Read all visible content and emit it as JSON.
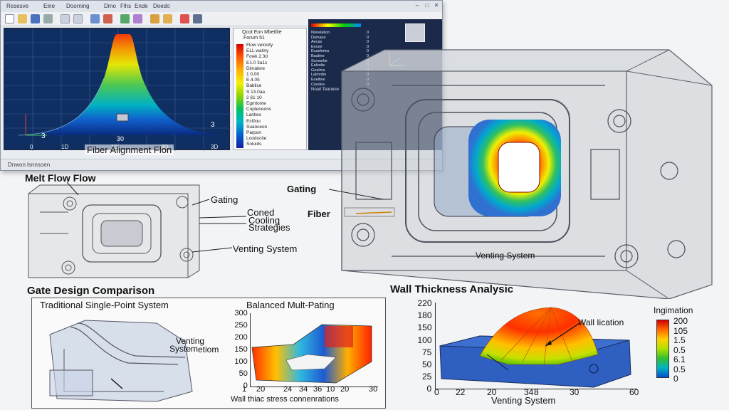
{
  "window": {
    "title_items": [
      "Resesve",
      "Eine",
      "Doorning",
      "Dmo",
      "Flhs",
      "Ende",
      "Deedo"
    ],
    "status_text": "Dnwon lsnnsoen",
    "toolbar_icons": [
      "new-icon",
      "open-icon",
      "save-icon",
      "print-icon",
      "undo-icon",
      "redo-icon",
      "zoom-icon",
      "rotate-icon",
      "mesh-icon",
      "analysis-icon",
      "results-icon",
      "folder-icon",
      "flag-icon",
      "camera-icon"
    ]
  },
  "plot": {
    "title": "Fiber Alignment Flon",
    "x_ticks": [
      "0",
      "1D",
      "10",
      "3D",
      "3D"
    ],
    "y_ticks": [
      "3",
      "3"
    ],
    "peak_label": "30"
  },
  "legend": {
    "header": "Qcot Eon Mbetilte",
    "subheader": "Forum 51",
    "colors": [
      "#d60000",
      "#ff5a00",
      "#ffb000",
      "#f3f000",
      "#8fd400",
      "#00c060",
      "#00b4c8",
      "#0060d0",
      "#1020a0"
    ],
    "entries": [
      "Flow velocity",
      "ELL waliny",
      "Fowk 2.3d",
      "E1.0 3a1s",
      "Dimalere",
      "1 0.00",
      "E.4.05",
      "Bablice",
      "S 13.0aa",
      "2 61 10",
      "Egmtonte",
      "Copteneons",
      "Larities",
      "Eci0ou",
      "Suanceon",
      "Parpon",
      "Loodocite",
      "Soluids"
    ]
  },
  "datapanel": {
    "rows": [
      "Nonelation",
      "Dumaos",
      "Aecas",
      "Eocee",
      "Ecaelmins",
      "Baalme",
      "Scmonlte",
      "Ealsnlie",
      "Goalma",
      "Lalmnbn",
      "Eoeltive",
      "Coodes"
    ],
    "values": [
      "0",
      "0",
      "0",
      "0",
      "0",
      "0",
      "0",
      "0",
      "0",
      "0",
      "0",
      "0"
    ],
    "footer": "Noarl Teaneoe"
  },
  "labels": {
    "melt_flow": "Melt Flow Flow",
    "gating_left": "Gating",
    "coned": "Coned",
    "cooling": "Cooling",
    "strategies": "Strategies",
    "fiber": "Fiber",
    "gating_right": "Gating",
    "venting_left": "Venting System",
    "venting_big": "Venting System"
  },
  "gate_section": {
    "title": "Gate Design Comparison",
    "left_title": "Traditional Single-Point System",
    "right_title": "Balanced Mult-Pating",
    "venting_label_1": "Venting",
    "venting_label_2": "System",
    "y_ticks": [
      "300",
      "250",
      "200",
      "150",
      "100",
      "50",
      "0"
    ],
    "x_ticks": [
      "1",
      "20",
      "24",
      "34",
      "36",
      "10",
      "20",
      "30"
    ],
    "xlabel": "Wall thiac stress connenrations"
  },
  "wall_section": {
    "title": "Wall Thickness Analysic",
    "y_ticks": [
      "220",
      "180",
      "150",
      "100",
      "75",
      "50",
      "25",
      "0"
    ],
    "x_ticks": [
      "0",
      "22",
      "20",
      "34",
      "8",
      "30",
      "60"
    ],
    "xlabel": "Venting System",
    "annotation": "Wall Iication",
    "colorbar_title": "Ingimation",
    "colorbar_ticks": [
      "200",
      "105",
      "1.5",
      "0.5",
      "6.1",
      "0.5",
      "0"
    ],
    "colorbar_colors": [
      "#d40000",
      "#ff6a00",
      "#ffd000",
      "#b0e000",
      "#30c030",
      "#00b4c0",
      "#0050d0"
    ]
  }
}
